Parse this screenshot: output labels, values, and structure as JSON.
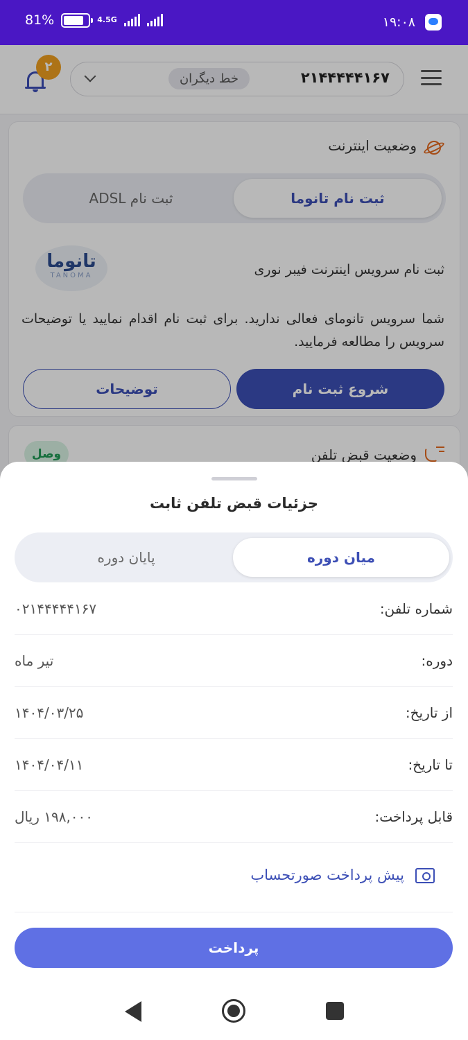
{
  "status_bar": {
    "time": "۱۹:۰۸",
    "battery": "81%",
    "battery_level": 0.81,
    "network": "4.5G"
  },
  "header": {
    "line_number": "۲۱۴۴۴۴۴۱۶۷",
    "other_line_label": "خط دیگران",
    "notification_count": "۲"
  },
  "internet_card": {
    "title": "وضعیت اینترنت",
    "tabs": [
      "ثبت نام تانوما",
      "ثبت نام ADSL"
    ],
    "signup_text": "ثبت نام سرویس اینترنت فیبر نوری",
    "logo_text": "تانوما",
    "logo_sub": "TANOMA",
    "description": "شما سرویس تانومای فعالی ندارید. برای ثبت نام اقدام نمایید یا توضیحات سرویس را مطالعه فرمایید.",
    "start_button": "شروع ثبت نام",
    "details_button": "توضیحات"
  },
  "phone_card": {
    "title": "وضعیت قبض تلفن",
    "status": "وصل"
  },
  "sheet": {
    "title": "جزئیات قبض تلفن ثابت",
    "tabs": [
      "میان دوره",
      "پایان دوره"
    ],
    "rows": [
      {
        "label": "شماره تلفن:",
        "value": "۰۲۱۴۴۴۴۴۱۶۷"
      },
      {
        "label": "دوره:",
        "value": "تیر ماه"
      },
      {
        "label": "از تاریخ:",
        "value": "۱۴۰۴/۰۳/۲۵"
      },
      {
        "label": "تا تاریخ:",
        "value": "۱۴۰۴/۰۴/۱۱"
      },
      {
        "label": "قابل پرداخت:",
        "value": "۱۹۸,۰۰۰ ریال"
      }
    ],
    "prepay_label": "پیش پرداخت صورتحساب",
    "pay_button": "پرداخت"
  }
}
